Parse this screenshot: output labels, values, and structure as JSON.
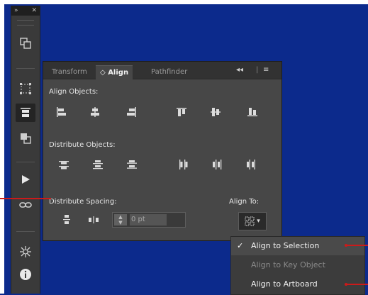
{
  "tool_strip": {
    "expand_glyph": "»",
    "close_glyph": "✕",
    "tools": [
      {
        "name": "artboards-icon",
        "active": false
      },
      {
        "name": "transform-icon",
        "active": false
      },
      {
        "name": "align-icon",
        "active": true
      },
      {
        "name": "pathfinder-icon",
        "active": false
      },
      {
        "name": "play-action-icon",
        "active": false
      },
      {
        "name": "links-icon",
        "active": false
      },
      {
        "name": "symbol-sprayer-icon",
        "active": false
      },
      {
        "name": "info-icon",
        "active": false
      }
    ]
  },
  "panel": {
    "tabs": {
      "transform": "Transform",
      "align_icon": "◇",
      "align": "Align",
      "pathfinder": "Pathfinder"
    },
    "collapse_glyph": "◂◂",
    "menu_glyph": "≡",
    "align_objects_label": "Align Objects:",
    "distribute_objects_label": "Distribute Objects:",
    "distribute_spacing_label": "Distribute Spacing:",
    "align_to_label": "Align To:",
    "spacing_value": "0 pt",
    "spin_up": "▲",
    "spin_down": "▼",
    "align_to_arrow": "▾"
  },
  "align_to_menu": {
    "items": [
      {
        "label": "Align to Selection",
        "checked": true,
        "enabled": true
      },
      {
        "label": "Align to Key Object",
        "checked": false,
        "enabled": false
      },
      {
        "label": "Align to Artboard",
        "checked": false,
        "enabled": true
      }
    ],
    "check_glyph": "✓"
  },
  "colors": {
    "background": "#0c2a8c",
    "panel": "#474747",
    "callout": "#cc1a1a"
  }
}
